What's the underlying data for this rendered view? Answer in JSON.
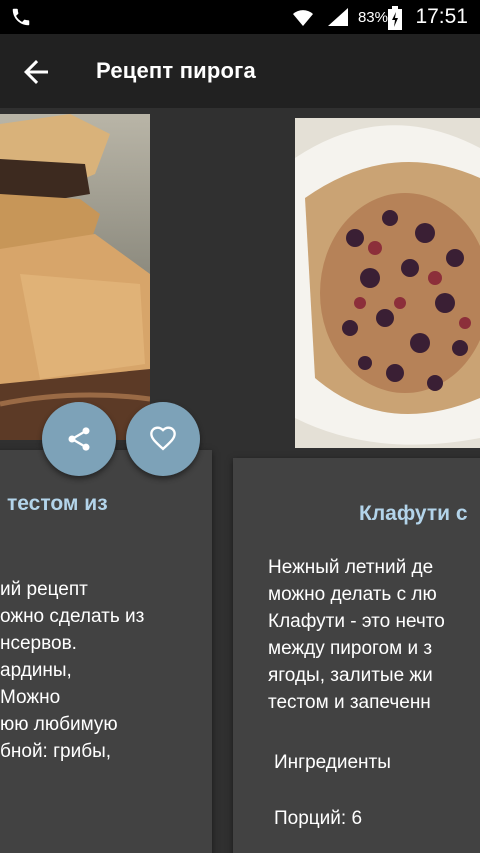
{
  "status_bar": {
    "battery_percent": "83%",
    "time": "17:51",
    "icons": [
      "phone-icon",
      "wifi-icon",
      "signal-icon",
      "battery-icon"
    ]
  },
  "app_bar": {
    "title": "Рецепт пирога",
    "back_icon": "arrow-back-icon"
  },
  "left_card": {
    "title": "тестом из",
    "lines": [
      "ий рецепт",
      "ожно сделать из",
      "нсервов.",
      "ардины,",
      "Можно",
      "юю любимую",
      "бной: грибы,"
    ],
    "share_icon": "share-icon",
    "like_icon": "heart-icon"
  },
  "right_card": {
    "title": "Клафути с",
    "lines": [
      "Нежный летний де",
      "можно делать с лю",
      "Клафути - это нечто",
      "между пирогом и з",
      "ягоды, залитые жи",
      "тестом и запеченн"
    ],
    "ingredients_label": "Ингредиенты",
    "servings_label": "Порций: 6"
  },
  "colors": {
    "background": "#303030",
    "app_bar": "#212121",
    "card": "#424242",
    "card_title": "#b3d4ea",
    "fab": "#7da2b8"
  }
}
